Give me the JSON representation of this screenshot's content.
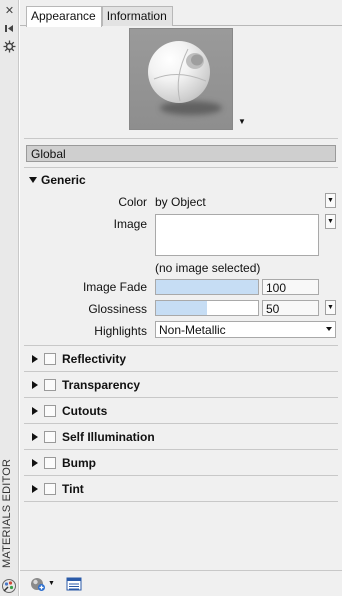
{
  "palette": {
    "title": "MATERIALS EDITOR"
  },
  "tabs": [
    {
      "label": "Appearance",
      "active": true
    },
    {
      "label": "Information",
      "active": false
    }
  ],
  "global_label": "Global",
  "generic": {
    "title": "Generic",
    "color": {
      "label": "Color",
      "value": "by Object"
    },
    "image": {
      "label": "Image",
      "status": "(no image selected)"
    },
    "image_fade": {
      "label": "Image Fade",
      "value": "100",
      "level": 1.0
    },
    "glossiness": {
      "label": "Glossiness",
      "value": "50",
      "level": 0.5
    },
    "highlights": {
      "label": "Highlights",
      "value": "Non-Metallic"
    }
  },
  "sections": [
    {
      "label": "Reflectivity"
    },
    {
      "label": "Transparency"
    },
    {
      "label": "Cutouts"
    },
    {
      "label": "Self Illumination"
    },
    {
      "label": "Bump"
    },
    {
      "label": "Tint"
    }
  ],
  "colors": {
    "slider_fill": "#c6ddf4",
    "panel_bg": "#f0f0f0",
    "global_bar": "#cfcfcf"
  }
}
